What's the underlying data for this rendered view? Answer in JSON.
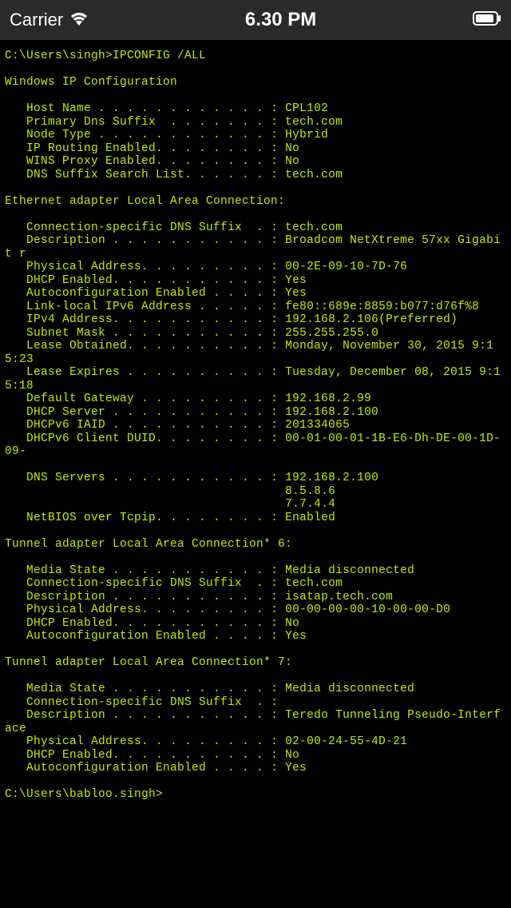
{
  "status": {
    "carrier": "Carrier",
    "time": "6.30 PM"
  },
  "terminal": {
    "color": "#cce600",
    "lines": [
      "C:\\Users\\singh>IPCONFIG /ALL",
      "",
      "Windows IP Configuration",
      "",
      "   Host Name . . . . . . . . . . . . : CPL102",
      "   Primary Dns Suffix  . . . . . . . : tech.com",
      "   Node Type . . . . . . . . . . . . : Hybrid",
      "   IP Routing Enabled. . . . . . . . : No",
      "   WINS Proxy Enabled. . . . . . . . : No",
      "   DNS Suffix Search List. . . . . . : tech.com",
      "",
      "Ethernet adapter Local Area Connection:",
      "",
      "   Connection-specific DNS Suffix  . : tech.com",
      "   Description . . . . . . . . . . . : Broadcom NetXtreme 57xx Gigabit r",
      "   Physical Address. . . . . . . . . : 00-2E-09-10-7D-76",
      "   DHCP Enabled. . . . . . . . . . . : Yes",
      "   Autoconfiguration Enabled . . . . : Yes",
      "   Link-local IPv6 Address . . . . . : fe80::689e:8859:b077:d76f%8",
      "   IPv4 Address. . . . . . . . . . . : 192.168.2.106(Preferred)",
      "   Subnet Mask . . . . . . . . . . . : 255.255.255.0",
      "   Lease Obtained. . . . . . . . . . : Monday, November 30, 2015 9:15:23",
      "   Lease Expires . . . . . . . . . . : Tuesday, December 08, 2015 9:15:18",
      "   Default Gateway . . . . . . . . . : 192.168.2.99",
      "   DHCP Server . . . . . . . . . . . : 192.168.2.100",
      "   DHCPv6 IAID . . . . . . . . . . . : 201334065",
      "   DHCPv6 Client DUID. . . . . . . . : 00-01-00-01-1B-E6-Dh-DE-00-1D-09-",
      "",
      "   DNS Servers . . . . . . . . . . . : 192.168.2.100",
      "                                       8.5.8.6",
      "                                       7.7.4.4",
      "   NetBIOS over Tcpip. . . . . . . . : Enabled",
      "",
      "Tunnel adapter Local Area Connection* 6:",
      "",
      "   Media State . . . . . . . . . . . : Media disconnected",
      "   Connection-specific DNS Suffix  . : tech.com",
      "   Description . . . . . . . . . . . : isatap.tech.com",
      "   Physical Address. . . . . . . . . : 00-00-00-00-10-00-00-D0",
      "   DHCP Enabled. . . . . . . . . . . : No",
      "   Autoconfiguration Enabled . . . . : Yes",
      "",
      "Tunnel adapter Local Area Connection* 7:",
      "",
      "   Media State . . . . . . . . . . . : Media disconnected",
      "   Connection-specific DNS Suffix  . :",
      "   Description . . . . . . . . . . . : Teredo Tunneling Pseudo-Interface",
      "   Physical Address. . . . . . . . . : 02-00-24-55-4D-21",
      "   DHCP Enabled. . . . . . . . . . . : No",
      "   Autoconfiguration Enabled . . . . : Yes",
      "",
      "C:\\Users\\babloo.singh>"
    ]
  }
}
